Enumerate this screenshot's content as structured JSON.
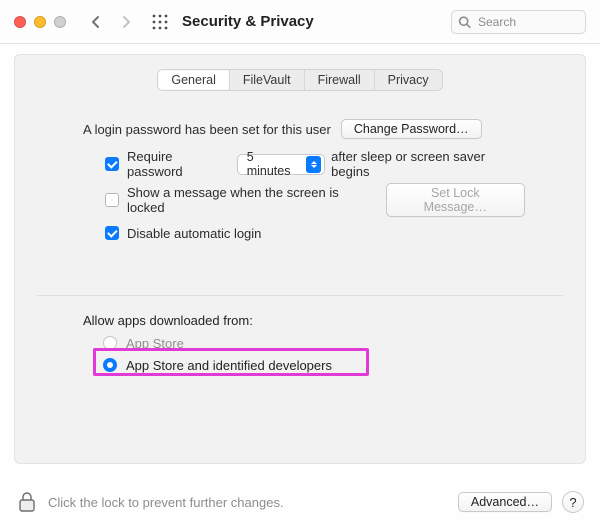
{
  "window": {
    "title": "Security & Privacy"
  },
  "search": {
    "placeholder": "Search"
  },
  "tabs": [
    {
      "label": "General",
      "selected": true
    },
    {
      "label": "FileVault",
      "selected": false
    },
    {
      "label": "Firewall",
      "selected": false
    },
    {
      "label": "Privacy",
      "selected": false
    }
  ],
  "loginPassword": {
    "setText": "A login password has been set for this user",
    "changeButton": "Change Password…",
    "requirePasswordLabel": "Require password",
    "requirePasswordChecked": true,
    "delayValue": "5 minutes",
    "afterText": "after sleep or screen saver begins",
    "showMessageLabel": "Show a message when the screen is locked",
    "showMessageChecked": false,
    "setLockMessageButton": "Set Lock Message…",
    "disableAutoLoginLabel": "Disable automatic login",
    "disableAutoLoginChecked": true
  },
  "gatekeeper": {
    "heading": "Allow apps downloaded from:",
    "options": [
      {
        "label": "App Store",
        "selected": false,
        "enabled": false
      },
      {
        "label": "App Store and identified developers",
        "selected": true,
        "enabled": true
      }
    ]
  },
  "footer": {
    "lockText": "Click the lock to prevent further changes.",
    "advancedButton": "Advanced…",
    "help": "?"
  }
}
